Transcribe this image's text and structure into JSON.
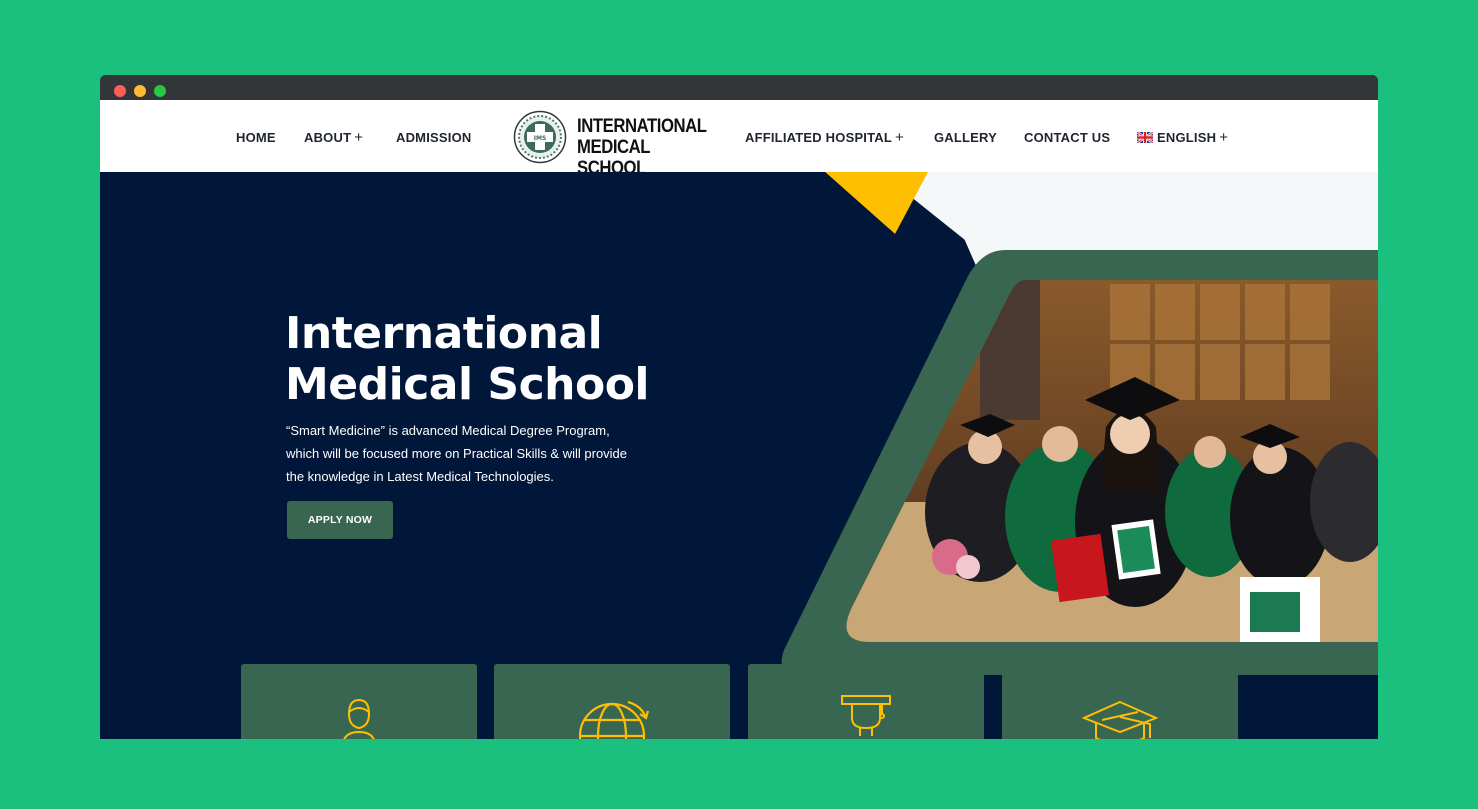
{
  "colors": {
    "background": "#1bbf7e",
    "hero_navy": "#011739",
    "accent_green": "#386651",
    "accent_yellow": "#febf00",
    "nav_text": "#1e2430"
  },
  "nav": {
    "home": "HOME",
    "about": "ABOUT",
    "admission": "ADMISSION",
    "affiliated_hospital": "AFFILIATED HOSPITAL",
    "gallery": "GALLERY",
    "contact_us": "CONTACT US",
    "language": "ENGLISH",
    "expand_symbol": "+"
  },
  "logo": {
    "line1": "INTERNATIONAL",
    "line2": "MEDICAL SCHOOL",
    "badge_text": "IMS"
  },
  "hero": {
    "title_line1": "International",
    "title_line2": "Medical School",
    "description": "“Smart Medicine” is advanced Medical Degree Program, which will be focused more on Practical Skills & will provide the knowledge in Latest Medical Technologies.",
    "apply_button": "APPLY NOW",
    "photo_icon": "graduation-ceremony-photo"
  },
  "feature_cards": [
    {
      "icon": "student-icon"
    },
    {
      "icon": "globe-icon"
    },
    {
      "icon": "graduate-cap-person-icon"
    },
    {
      "icon": "mortarboard-icon"
    }
  ]
}
